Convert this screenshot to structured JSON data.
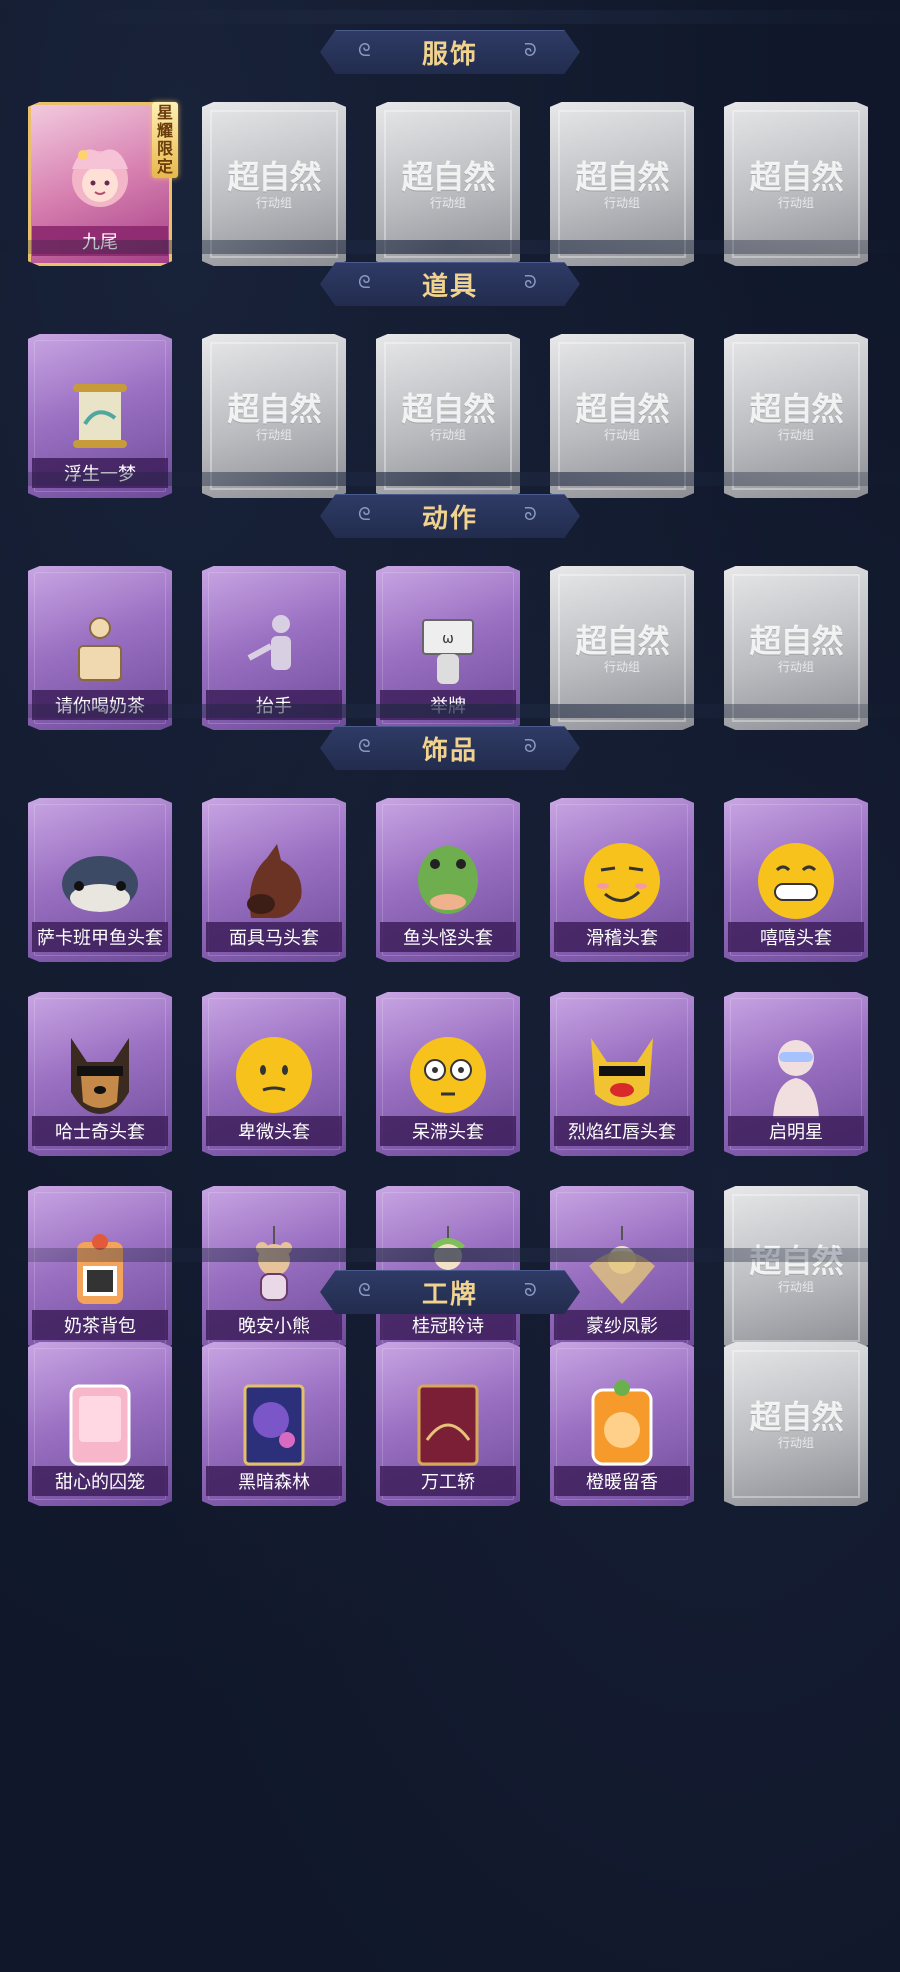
{
  "sections": [
    {
      "title": "服饰",
      "items": [
        {
          "label": "九尾",
          "state": "gold",
          "badge": "星耀限定",
          "icon": "fox-girl-portrait"
        },
        {
          "label": "",
          "state": "empty"
        },
        {
          "label": "",
          "state": "empty"
        },
        {
          "label": "",
          "state": "empty"
        },
        {
          "label": "",
          "state": "empty"
        }
      ]
    },
    {
      "title": "道具",
      "items": [
        {
          "label": "浮生一梦",
          "state": "filled",
          "icon": "scroll-icon"
        },
        {
          "label": "",
          "state": "empty"
        },
        {
          "label": "",
          "state": "empty"
        },
        {
          "label": "",
          "state": "empty"
        },
        {
          "label": "",
          "state": "empty"
        }
      ]
    },
    {
      "title": "动作",
      "items": [
        {
          "label": "请你喝奶茶",
          "state": "filled",
          "icon": "milk-tea-gesture-icon"
        },
        {
          "label": "抬手",
          "state": "filled",
          "icon": "raise-hand-icon"
        },
        {
          "label": "举牌",
          "state": "filled",
          "icon": "hold-sign-icon"
        },
        {
          "label": "",
          "state": "empty"
        },
        {
          "label": "",
          "state": "empty"
        }
      ]
    },
    {
      "title": "饰品",
      "items": [
        {
          "label": "萨卡班甲鱼头套",
          "state": "filled",
          "icon": "fish-head-icon"
        },
        {
          "label": "面具马头套",
          "state": "filled",
          "icon": "horse-head-icon"
        },
        {
          "label": "鱼头怪头套",
          "state": "filled",
          "icon": "green-fish-head-icon"
        },
        {
          "label": "滑稽头套",
          "state": "filled",
          "icon": "funny-face-icon"
        },
        {
          "label": "嘻嘻头套",
          "state": "filled",
          "icon": "grin-face-icon"
        },
        {
          "label": "哈士奇头套",
          "state": "filled",
          "icon": "husky-head-icon"
        },
        {
          "label": "卑微头套",
          "state": "filled",
          "icon": "humble-face-icon"
        },
        {
          "label": "呆滞头套",
          "state": "filled",
          "icon": "dazed-face-icon"
        },
        {
          "label": "烈焰红唇头套",
          "state": "filled",
          "icon": "red-lips-head-icon"
        },
        {
          "label": "启明星",
          "state": "filled",
          "icon": "star-glasses-icon"
        },
        {
          "label": "奶茶背包",
          "state": "filled",
          "icon": "milk-tea-bag-icon"
        },
        {
          "label": "晚安小熊",
          "state": "filled",
          "icon": "bear-charm-icon"
        },
        {
          "label": "桂冠聆诗",
          "state": "filled",
          "icon": "laurel-charm-icon"
        },
        {
          "label": "蒙纱凤影",
          "state": "filled",
          "icon": "phoenix-charm-icon"
        },
        {
          "label": "",
          "state": "empty"
        }
      ]
    },
    {
      "title": "工牌",
      "items": [
        {
          "label": "甜心的囚笼",
          "state": "filled",
          "icon": "pink-badge-icon"
        },
        {
          "label": "黑暗森林",
          "state": "filled",
          "icon": "galaxy-badge-icon"
        },
        {
          "label": "万工轿",
          "state": "filled",
          "icon": "red-badge-icon"
        },
        {
          "label": "橙暖留香",
          "state": "filled",
          "icon": "orange-badge-icon"
        },
        {
          "label": "",
          "state": "empty"
        }
      ]
    }
  ],
  "placeholder": {
    "line1": "超自然",
    "line2": "行动组"
  }
}
